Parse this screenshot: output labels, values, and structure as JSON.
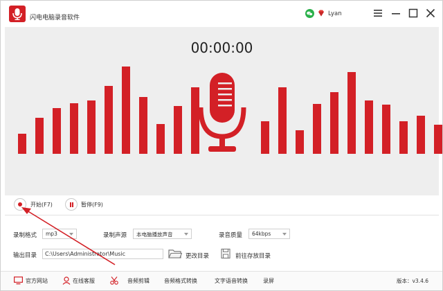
{
  "app": {
    "title": "闪电电脑录音软件",
    "user_name": "Lyan"
  },
  "window_controls": [
    "menu-icon",
    "minimize-icon",
    "maximize-icon",
    "close-icon"
  ],
  "timer": "00:00:00",
  "visualizer": {
    "accent_color": "#d32026",
    "left_levels": [
      0.23,
      0.41,
      0.52,
      0.58,
      0.61,
      0.78,
      1.0,
      0.65,
      0.34,
      0.55,
      0.76
    ],
    "right_levels": [
      0.37,
      0.76,
      0.27,
      0.57,
      0.71,
      0.94,
      0.61,
      0.56,
      0.37,
      0.44,
      0.33
    ]
  },
  "controls": {
    "start_label": "开始(F7)",
    "pause_label": "暂停(F9)"
  },
  "settings": {
    "format_label": "录制格式",
    "format_value": "mp3",
    "source_label": "录制声源",
    "source_value": "本电脑播放声音",
    "quality_label": "录音质量",
    "quality_value": "64kbps",
    "output_label": "输出目录",
    "output_path": "C:\\Users\\Administrator\\Music",
    "change_dir_label": "更改目录",
    "open_dir_label": "前往存放目录"
  },
  "toolbar": {
    "official_site": "官方网站",
    "online_service": "在线客服",
    "audio_edit": "音频剪辑",
    "format_convert": "音频格式转换",
    "tts": "文字语音转换",
    "screen_record": "录屏"
  },
  "version": "版本：v3.4.6"
}
